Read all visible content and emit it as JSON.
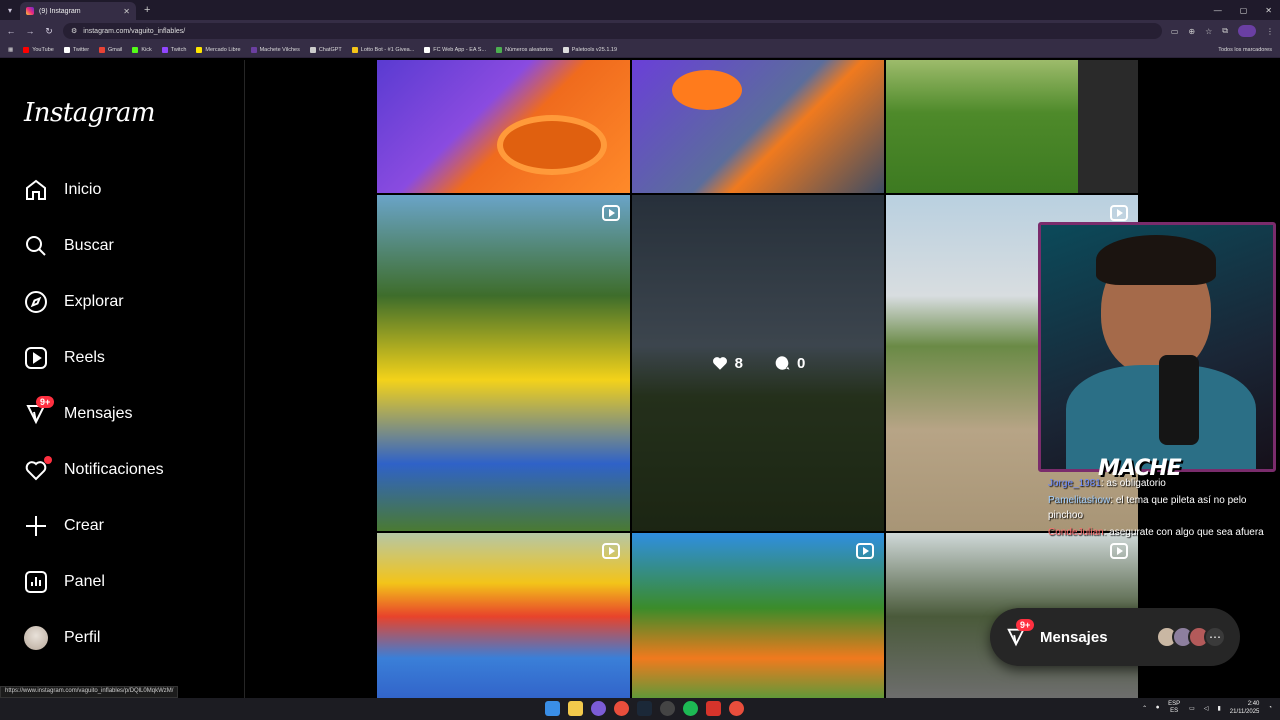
{
  "browser": {
    "tab_title": "(9) Instagram",
    "url": "instagram.com/vaguito_inflables/",
    "status_url": "https://www.instagram.com/vaguito_inflables/p/DQlL0MqkWzM/",
    "bookmarks": [
      {
        "label": "YouTube",
        "color": "#ff0000"
      },
      {
        "label": "Twitter",
        "color": "#ffffff"
      },
      {
        "label": "Gmail",
        "color": "#ea4335"
      },
      {
        "label": "Kick",
        "color": "#53fc18"
      },
      {
        "label": "Twitch",
        "color": "#9146ff"
      },
      {
        "label": "Mercado Libre",
        "color": "#ffe600"
      },
      {
        "label": "Machete Vilches",
        "color": "#6b3fa0"
      },
      {
        "label": "ChatGPT",
        "color": "#cccccc"
      },
      {
        "label": "Lotto Bot - #1 Givea...",
        "color": "#f5c518"
      },
      {
        "label": "FC Web App - EA S...",
        "color": "#ffffff"
      },
      {
        "label": "Números aleatorios",
        "color": "#4caf50"
      },
      {
        "label": "Paletools v25.1.19",
        "color": "#dddddd"
      }
    ],
    "all_bookmarks": "Todos los marcadores"
  },
  "sidebar": {
    "logo": "Instagram",
    "items": [
      {
        "label": "Inicio",
        "icon": "home-icon"
      },
      {
        "label": "Buscar",
        "icon": "search-icon"
      },
      {
        "label": "Explorar",
        "icon": "compass-icon"
      },
      {
        "label": "Reels",
        "icon": "reels-icon"
      },
      {
        "label": "Mensajes",
        "icon": "messenger-icon",
        "badge": "9+"
      },
      {
        "label": "Notificaciones",
        "icon": "heart-icon"
      },
      {
        "label": "Crear",
        "icon": "plus-icon"
      },
      {
        "label": "Panel",
        "icon": "chart-icon"
      },
      {
        "label": "Perfil",
        "icon": "avatar"
      }
    ]
  },
  "hover_post": {
    "likes": "8",
    "comments": "0"
  },
  "stream": {
    "brand": "MACHE",
    "chat": [
      {
        "user": "Jorge_1981",
        "text": "as obligatorio"
      },
      {
        "user": "Pamelitashow",
        "text": "el tema que pileta así no pelo pinchoo"
      },
      {
        "user": "CondeJulian",
        "text": "asegurate con algo que sea afuera"
      }
    ]
  },
  "messages_pill": {
    "label": "Mensajes",
    "badge": "9+"
  },
  "taskbar": {
    "lang": "ESP",
    "lang2": "ES",
    "time": "2:40",
    "date": "21/11/2025"
  },
  "colors": {
    "instagram_red": "#ff3040",
    "chrome_purple": "#352d45"
  }
}
